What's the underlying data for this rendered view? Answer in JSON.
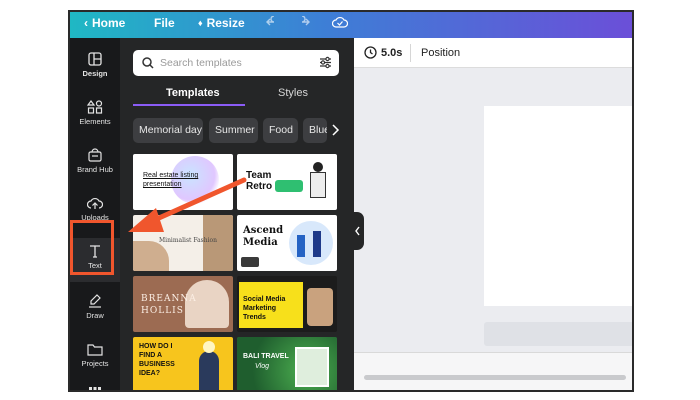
{
  "topbar": {
    "home": "Home",
    "file": "File",
    "resize": "Resize"
  },
  "sidebar": {
    "items": [
      {
        "label": "Design",
        "icon": "design-icon"
      },
      {
        "label": "Elements",
        "icon": "elements-icon"
      },
      {
        "label": "Brand Hub",
        "icon": "brand-hub-icon"
      },
      {
        "label": "Uploads",
        "icon": "upload-cloud-icon"
      },
      {
        "label": "Text",
        "icon": "text-icon"
      },
      {
        "label": "Draw",
        "icon": "draw-icon"
      },
      {
        "label": "Projects",
        "icon": "folder-icon"
      }
    ]
  },
  "panel": {
    "search_placeholder": "Search templates",
    "tabs": [
      "Templates",
      "Styles"
    ],
    "chips": [
      "Memorial day",
      "Summer",
      "Food",
      "Blue"
    ],
    "tiles": {
      "t1": {
        "title": "Real estate listing",
        "title2": "presentation"
      },
      "t2": {
        "title": "Team",
        "title2": "Retro"
      },
      "t3": {
        "title": "Minimalist Fashion"
      },
      "t4": {
        "title": "Ascend",
        "title2": "Media"
      },
      "t5": {
        "title": "BREANNA",
        "title2": "HOLLIS"
      },
      "t6": {
        "title": "Social Media",
        "title2": "Marketing",
        "title3": "Trends"
      },
      "t7": {
        "title": "HOW DO I",
        "title2": "FIND A",
        "title3": "BUSINESS",
        "title4": "IDEA?"
      },
      "t8": {
        "title": "BALI TRAVEL",
        "title2": "Vlog"
      }
    }
  },
  "editor": {
    "duration": "5.0s",
    "position": "Position"
  },
  "colors": {
    "highlight": "#f0562d",
    "tab_underline": "#8b5cf6"
  }
}
